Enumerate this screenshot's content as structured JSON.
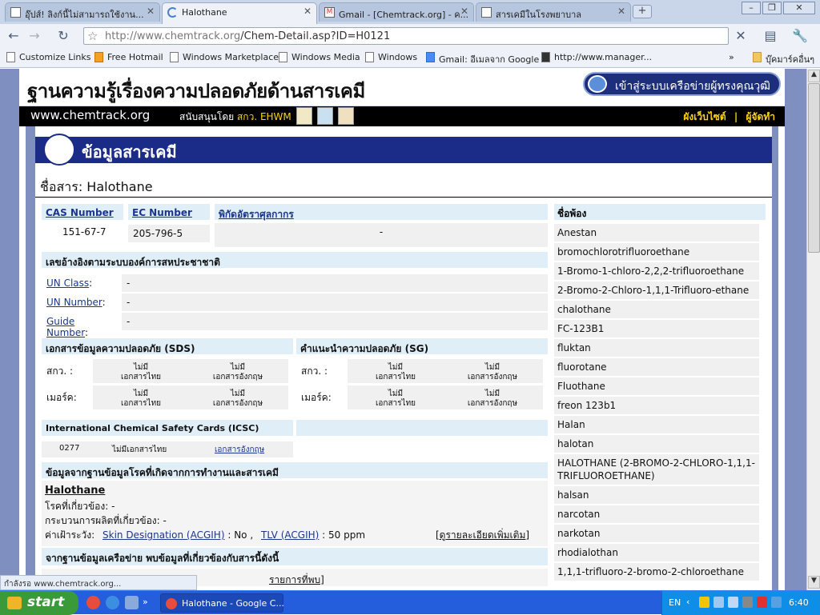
{
  "tabs": [
    {
      "label": "อุ๊ปส์! ลิงก์นี้ไม่สามารถใช้งาน..."
    },
    {
      "label": "Halothane"
    },
    {
      "label": "Gmail - [Chemtrack.org] - ค..."
    },
    {
      "label": "สารเคมีในโรงพยาบาล"
    }
  ],
  "address": {
    "domain": "http://www.chemtrack.org",
    "path": "/Chem-Detail.asp?ID=H0121"
  },
  "bookmarks": [
    "Customize Links",
    "Free Hotmail",
    "Windows Marketplace",
    "Windows Media",
    "Windows",
    "Gmail: อีเมลจาก Google",
    "http://www.manager...",
    "บุ๊คมาร์คอื่นๆ"
  ],
  "site": {
    "title": "ฐานความรู้เรื่องความปลอดภัยด้านสารเคมี",
    "login": "เข้าสู่ระบบเครือข่ายผู้ทรงคุณวุฒิ",
    "url": "www.chemtrack.org",
    "support_prefix": "สนับสนุนโดย",
    "support_org": "สกว. EHWM",
    "sitemap": "ผังเว็บไซต์",
    "separator": "|",
    "admin": "ผู้จัดทำ"
  },
  "banner": "ข้อมูลสารเคมี",
  "substance": "ชื่อสาร: Halothane",
  "ids": {
    "cas_label": "CAS Number",
    "cas_value": "151-67-7",
    "ec_label": "EC Number",
    "ec_value": "205-796-5",
    "customs_label": "พิกัดอัตราศุลกากร",
    "customs_value": "-"
  },
  "un": {
    "heading": "เลขอ้างอิงตามระบบองค์การสหประชาชาติ",
    "rows": [
      {
        "label": "UN Class",
        "value": "-"
      },
      {
        "label": "UN Number",
        "value": "-"
      },
      {
        "label": "Guide Number",
        "value": "-"
      }
    ]
  },
  "sds": {
    "heading": "เอกสารข้อมูลความปลอดภัย (SDS)",
    "rows": [
      {
        "label": "สกว. :",
        "a1": "ไม่มี",
        "a2": "เอกสารไทย",
        "b1": "ไม่มี",
        "b2": "เอกสารอังกฤษ"
      },
      {
        "label": "เมอร์ค:",
        "a1": "ไม่มี",
        "a2": "เอกสารไทย",
        "b1": "ไม่มี",
        "b2": "เอกสารอังกฤษ"
      }
    ]
  },
  "sg": {
    "heading": "คำแนะนำความปลอดภัย (SG)",
    "rows": [
      {
        "label": "สกว. :",
        "a1": "ไม่มี",
        "a2": "เอกสารไทย",
        "b1": "ไม่มี",
        "b2": "เอกสารอังกฤษ"
      },
      {
        "label": "เมอร์ค:",
        "a1": "ไม่มี",
        "a2": "เอกสารไทย",
        "b1": "ไม่มี",
        "b2": "เอกสารอังกฤษ"
      }
    ]
  },
  "icsc": {
    "heading": "International Chemical Safety Cards (ICSC)",
    "number": "0277",
    "thai": "ไม่มีเอกสารไทย",
    "english": "เอกสารอังกฤษ"
  },
  "occ": {
    "heading": "ข้อมูลจากฐานข้อมูลโรคที่เกิดจากการทำงานและสารเคมี",
    "name": "Halothane",
    "disease_label": "โรคที่เกี่ยวข้อง:",
    "disease_value": "-",
    "process_label": "กระบวนการผลิตที่เกี่ยวข้อง:",
    "process_value": "-",
    "watch_label": "ค่าเฝ้าระวัง:",
    "skin_link": "Skin Designation (ACGIH)",
    "skin_value": ": No ,",
    "tlv_link": "TLV (ACGIH)",
    "tlv_value": ": 50 ppm",
    "more_link": "[ดูรายละเอียดเพิ่มเติม]"
  },
  "network": {
    "heading": "จากฐานข้อมูลเครือข่าย พบข้อมูลที่เกี่ยวข้องกับสารนี้ดังนี้",
    "link": "รายการที่พบ]"
  },
  "synonyms": {
    "heading": "ชื่อพ้อง",
    "items": [
      "Anestan",
      "bromochlorotrifluoroethane",
      "1-Bromo-1-chloro-2,2,2-trifluoroethane",
      "2-Bromo-2-Chloro-1,1,1-Trifluoro-ethane",
      "chalothane",
      "FC-123B1",
      "fluktan",
      "fluorotane",
      "Fluothane",
      "freon 123b1",
      "Halan",
      "halotan",
      "HALOTHANE (2-BROMO-2-CHLORO-1,1,1-TRIFLUOROETHANE)",
      "halsan",
      "narcotan",
      "narkotan",
      "rhodialothan",
      "1,1,1-trifluoro-2-bromo-2-chloroethane"
    ]
  },
  "status": "กำลังรอ www.chemtrack.org...",
  "taskbar": {
    "start": "start",
    "task": "Halothane - Google C...",
    "lang": "EN",
    "clock": "6:40"
  }
}
